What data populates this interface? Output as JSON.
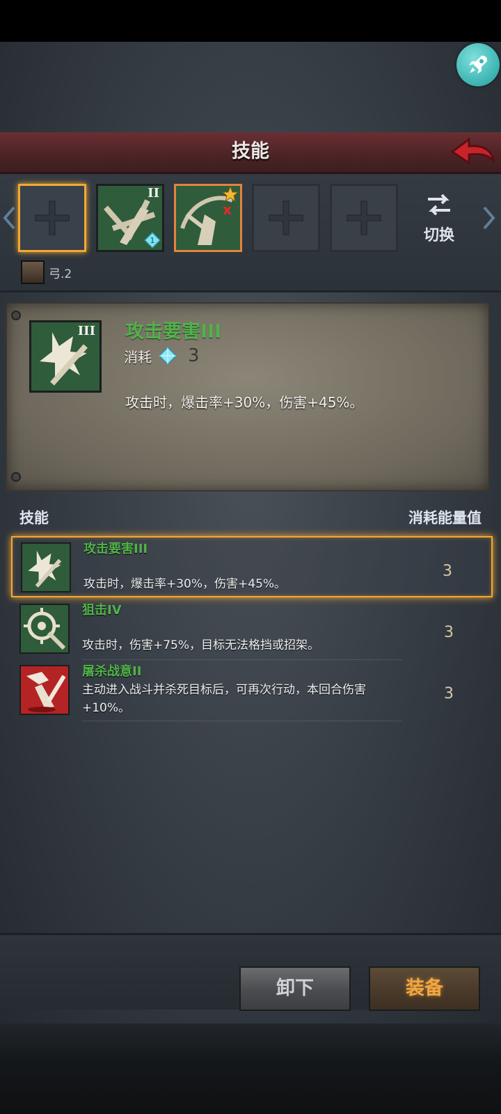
{
  "header": {
    "title": "技能"
  },
  "slots": {
    "switch_label": "切换",
    "character_label": "弓.2",
    "slot2": {
      "roman": "II",
      "gem_count": "1"
    }
  },
  "detail": {
    "name": "攻击要害III",
    "roman": "III",
    "cost_label": "消耗",
    "cost_value": "3",
    "description": "攻击时，爆击率+30%，伤害+45%。"
  },
  "list": {
    "col_left": "技能",
    "col_right": "消耗能量值",
    "items": [
      {
        "name": "攻击要害III",
        "desc": "攻击时，爆击率+30%，伤害+45%。",
        "cost": "3"
      },
      {
        "name": "狙击IV",
        "desc": "攻击时，伤害+75%，目标无法格挡或招架。",
        "cost": "3"
      },
      {
        "name": "屠杀战意II",
        "desc": "主动进入战斗并杀死目标后，可再次行动，本回合伤害+10%。",
        "cost": "3"
      }
    ]
  },
  "buttons": {
    "unequip": "卸下",
    "equip": "装备"
  },
  "colors": {
    "accent": "#f2a832",
    "skill_name": "#52b24a",
    "equip_text": "#f3a640"
  }
}
